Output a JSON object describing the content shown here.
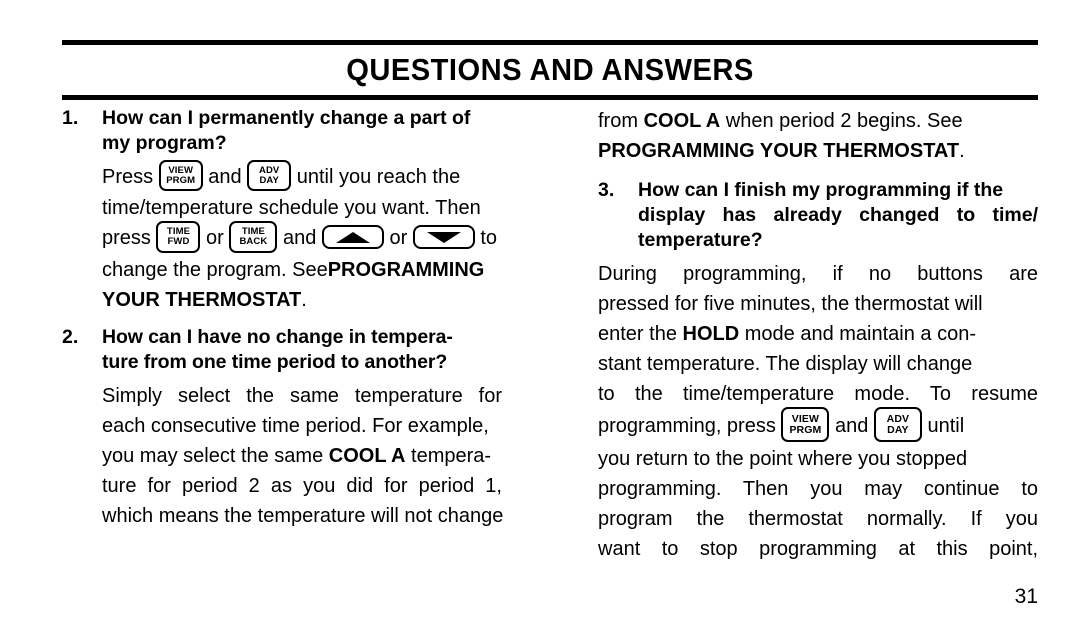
{
  "header": {
    "title": "QUESTIONS AND ANSWERS"
  },
  "buttons": {
    "view_prgm": {
      "line1": "VIEW",
      "line2": "PRGM"
    },
    "adv_day": {
      "line1": "ADV",
      "line2": "DAY"
    },
    "time_fwd": {
      "line1": "TIME",
      "line2": "FWD"
    },
    "time_back": {
      "line1": "TIME",
      "line2": "BACK"
    },
    "up_arrow": {
      "label": "up-arrow"
    },
    "down_arrow": {
      "label": "down-arrow"
    }
  },
  "left_column": {
    "q1": {
      "number": "1.",
      "question_line1": "How can I permanently change a part of",
      "question_line2": "my program?",
      "answer": {
        "l1_a": "Press",
        "l1_b": "and",
        "l1_c": "until you reach the",
        "l2": "time/temperature schedule you want. Then",
        "l3_a": "press",
        "l3_b": "or",
        "l3_c": "and",
        "l3_d": "or",
        "l3_e": "to",
        "l4_a": "change the program. See",
        "l4_bold": "PROGRAMMING",
        "l5_bold": "YOUR THERMOSTAT",
        "l5_end": "."
      }
    },
    "q2": {
      "number": "2.",
      "question_line1": "How can I have no change in tempera-",
      "question_line2": "ture from one time period to another?",
      "answer": {
        "l1": "Simply select the same temperature for",
        "l2": "each consecutive time period. For example,",
        "l3_a": "you may select the same",
        "l3_bold": "COOL A",
        "l3_b": "tempera-",
        "l4": "ture for period 2 as you did for period 1,",
        "l5": "which means the temperature will not change"
      }
    }
  },
  "right_column": {
    "continuation": {
      "l1_a": "from",
      "l1_bold": "COOL A",
      "l1_b": "when period 2 begins. See",
      "l2_bold": "PROGRAMMING YOUR THERMOSTAT",
      "l2_end": "."
    },
    "q3": {
      "number": "3.",
      "question_line1": "How can I finish my programming if the",
      "question_line2": "display has already changed to time/",
      "question_line3": "temperature?",
      "answer": {
        "l1": "During programming, if no buttons are",
        "l2": "pressed for five minutes, the thermostat will",
        "l3_a": "enter the",
        "l3_bold": "HOLD",
        "l3_b": "mode and maintain a con-",
        "l4": "stant temperature. The display will change",
        "l5": "to the time/temperature mode. To resume",
        "l6_a": "programming, press",
        "l6_b": "and",
        "l6_c": "until",
        "l7": "you return to the point where you stopped",
        "l8": "programming. Then you may continue to",
        "l9": "program the thermostat normally. If you",
        "l10": "want to stop programming at this point,"
      }
    }
  },
  "footer": {
    "page_number": "31"
  }
}
